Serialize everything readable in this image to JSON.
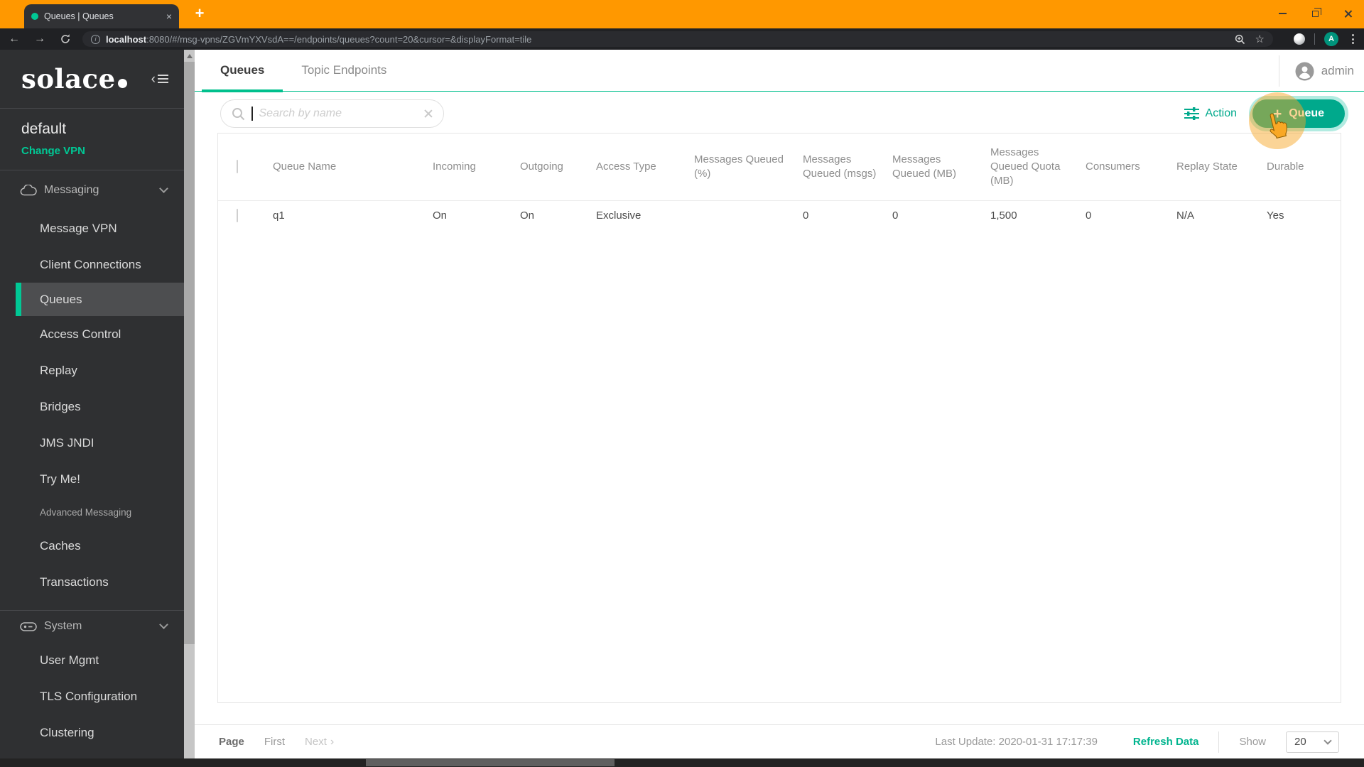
{
  "colors": {
    "brand_green": "#00C895",
    "button_green": "#00A98C",
    "frame_orange": "#FF9800",
    "avatar_teal": "#00947C",
    "sidebar_bg": "#2F3032"
  },
  "browser": {
    "tab_title": "Queues | Queues",
    "new_tab_label": "+",
    "url_host": "localhost",
    "url_rest": ":8080/#/msg-vpns/ZGVmYXVsdA==/endpoints/queues?count=20&cursor=&displayFormat=tile",
    "avatar_letter": "A",
    "icons": {
      "back": "←",
      "forward": "→",
      "star": "☆"
    }
  },
  "sidebar": {
    "logo_text": "solace",
    "vpn_name": "default",
    "change_vpn_label": "Change VPN",
    "sections": {
      "messaging": "Messaging",
      "advanced": "Advanced Messaging",
      "system": "System"
    },
    "messaging_items": [
      "Message VPN",
      "Client Connections",
      "Queues",
      "Access Control",
      "Replay",
      "Bridges",
      "JMS JNDI",
      "Try Me!"
    ],
    "advanced_items": [
      "Caches",
      "Transactions"
    ],
    "system_items": [
      "User Mgmt",
      "TLS Configuration",
      "Clustering"
    ],
    "selected_item": "Queues"
  },
  "main": {
    "tabs": [
      "Queues",
      "Topic Endpoints"
    ],
    "active_tab": "Queues",
    "user_label": "admin",
    "search_placeholder": "Search by name",
    "action_label": "Action",
    "add_queue_plus": "+",
    "add_queue_label": "Queue",
    "table": {
      "columns": [
        "Queue Name",
        "Incoming",
        "Outgoing",
        "Access Type",
        "Messages Queued (%)",
        "Messages Queued (msgs)",
        "Messages Queued (MB)",
        "Messages Queued Quota (MB)",
        "Consumers",
        "Replay State",
        "Durable"
      ],
      "row": {
        "queue_name": "q1",
        "incoming": "On",
        "outgoing": "On",
        "access_type": "Exclusive",
        "queued_pct_fill": 0,
        "queued_pct_marker": 77,
        "queued_msgs": "0",
        "queued_mb": "0",
        "queued_quota_mb": "1,500",
        "consumers": "0",
        "replay_state": "N/A",
        "durable": "Yes"
      }
    },
    "footer": {
      "page_label": "Page",
      "first_label": "First",
      "next_label": "Next",
      "next_chevron": "›",
      "last_update": "Last Update: 2020-01-31 17:17:39",
      "refresh_label": "Refresh Data",
      "show_label": "Show",
      "page_size": "20"
    }
  }
}
